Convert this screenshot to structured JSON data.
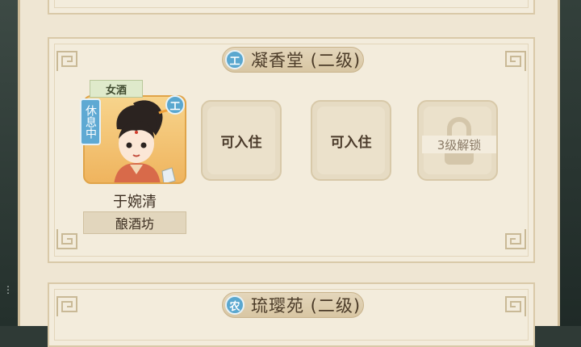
{
  "sections": [
    {
      "title": "凝香堂 (二级)",
      "type_badge": "工",
      "type_color": "#5aa7cf",
      "resident": {
        "name": "于婉清",
        "role_tag": "女酒",
        "status": "休息中",
        "badge": "工",
        "workplace": "酿酒坊"
      },
      "slots": [
        {
          "label": "可入住"
        },
        {
          "label": "可入住"
        },
        {
          "label": "3级解锁",
          "locked": true
        }
      ]
    },
    {
      "title": "琉璎苑 (二级)",
      "type_badge": "农",
      "type_color": "#5aa7cf"
    }
  ]
}
